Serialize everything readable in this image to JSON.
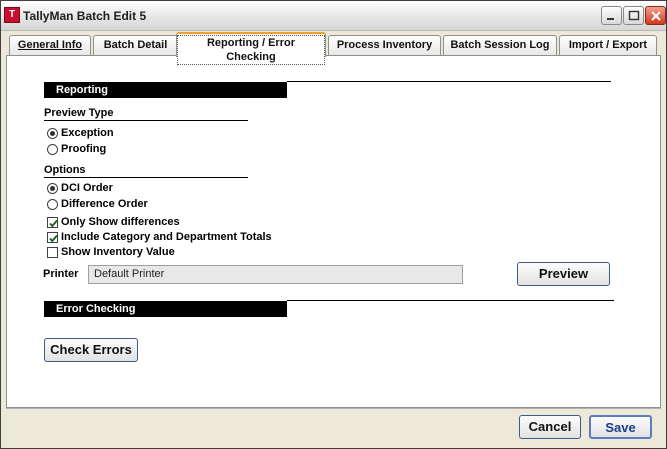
{
  "window": {
    "title": "TallyMan Batch Edit 5",
    "app_icon_glyph": "T",
    "app_icon": "tallyman-app-icon",
    "controls": [
      "minimize-icon",
      "maximize-icon",
      "close-icon"
    ]
  },
  "tabs": [
    {
      "label": "General Info"
    },
    {
      "label": "Batch Detail"
    },
    {
      "label": "Reporting / Error Checking"
    },
    {
      "label": "Process Inventory"
    },
    {
      "label": "Batch Session Log"
    },
    {
      "label": "Import / Export"
    }
  ],
  "active_tab": "Reporting / Error Checking",
  "reporting": {
    "header": "Reporting",
    "preview_type": {
      "label": "Preview Type",
      "options": [
        {
          "label": "Exception",
          "selected": true
        },
        {
          "label": "Proofing",
          "selected": false
        }
      ]
    },
    "options": {
      "label": "Options",
      "order": [
        {
          "label": "DCI Order",
          "selected": true
        },
        {
          "label": "Difference Order",
          "selected": false
        }
      ],
      "checkboxes": [
        {
          "label": "Only Show differences",
          "checked": true
        },
        {
          "label": "Include Category and Department Totals",
          "checked": true
        },
        {
          "label": "Show Inventory Value",
          "checked": false
        }
      ]
    },
    "printer_label": "Printer",
    "printer_value": "Default Printer",
    "preview_button": "Preview"
  },
  "error_checking": {
    "header": "Error Checking",
    "check_errors_button": "Check Errors"
  },
  "footer": {
    "cancel_button": "Cancel",
    "save_button": "Save"
  },
  "colors": {
    "section_bar": "#000000",
    "active_tab_accent": "#f0a030",
    "close_button": "#d2381e"
  }
}
